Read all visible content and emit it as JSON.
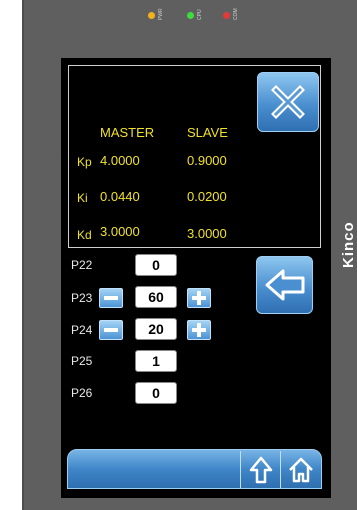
{
  "brand": "Kinco",
  "leds": [
    {
      "label": "PWR",
      "color": "#f2b21c"
    },
    {
      "label": "CPU",
      "color": "#3ddc3d"
    },
    {
      "label": "COM",
      "color": "#e23a3a"
    }
  ],
  "pid": {
    "headers": {
      "master": "MASTER",
      "slave": "SLAVE"
    },
    "rows": [
      {
        "label": "Kp",
        "master": "4.0000",
        "slave": "0.9000"
      },
      {
        "label": "Ki",
        "master": "0.0440",
        "slave": "0.0200"
      },
      {
        "label": "Kd",
        "master": "3.0000",
        "slave": "3.0000"
      }
    ]
  },
  "params": [
    {
      "label": "P22",
      "value": "0"
    },
    {
      "label": "P23",
      "value": "60"
    },
    {
      "label": "P24",
      "value": "20"
    },
    {
      "label": "P25",
      "value": "1"
    },
    {
      "label": "P26",
      "value": "0"
    }
  ],
  "icons": {
    "close": "close-x-icon",
    "back": "back-arrow-icon",
    "minus": "minus-icon",
    "plus": "plus-icon",
    "up": "up-arrow-icon",
    "home": "home-icon"
  },
  "colors": {
    "screen": "#000000",
    "text_yellow": "#f0e12a",
    "button_blue": "#4a8fd0",
    "bezel": "#5f5f5f"
  }
}
